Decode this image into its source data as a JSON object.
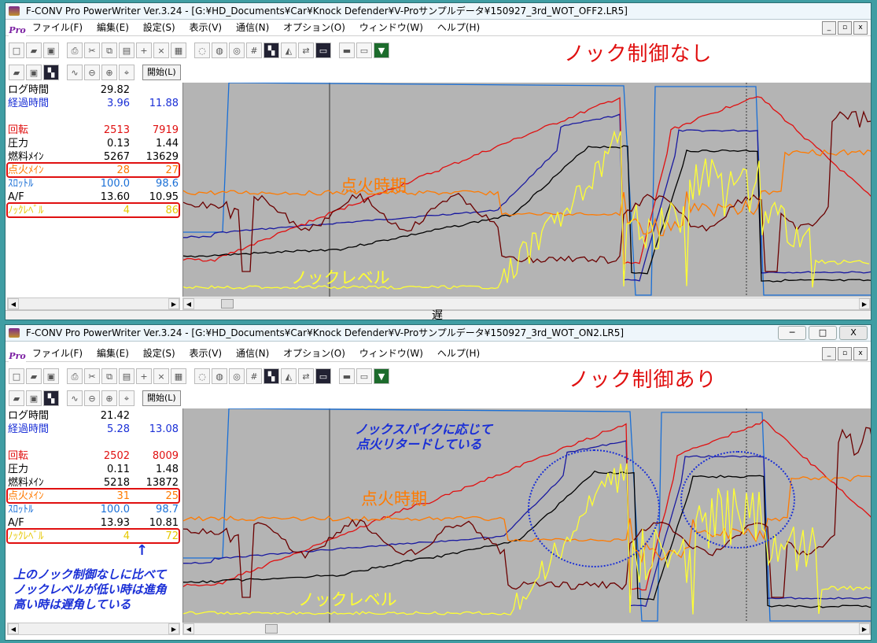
{
  "windows": [
    {
      "title": "F-CONV Pro PowerWriter Ver.3.24 - [G:¥HD_Documents¥Car¥Knock Defender¥V-Proサンプルデータ¥150927_3rd_WOT_OFF2.LR5]",
      "heading": "ノック制御なし",
      "rows": [
        {
          "label": "ログ時間",
          "v1": "29.82",
          "v2": "",
          "color": "#000000"
        },
        {
          "label": "経過時間",
          "v1": "3.96",
          "v2": "11.88",
          "color": "#1a2fd6"
        },
        {
          "label": "回転",
          "v1": "2513",
          "v2": "7919",
          "color": "#e01010"
        },
        {
          "label": "圧力",
          "v1": "0.13",
          "v2": "1.44",
          "color": "#000000"
        },
        {
          "label": "燃料ﾒｲﾝ",
          "v1": "5267",
          "v2": "13629",
          "color": "#000000"
        },
        {
          "label": "点火ﾒｲﾝ",
          "v1": "28",
          "v2": "27",
          "color": "#ff7a00"
        },
        {
          "label": "ｽﾛｯﾄﾙ",
          "v1": "100.0",
          "v2": "98.6",
          "color": "#1a6fd6"
        },
        {
          "label": "A/F",
          "v1": "13.60",
          "v2": "10.95",
          "color": "#000000"
        },
        {
          "label": "ﾉｯｸﾚﾍﾞﾙ",
          "v1": "4",
          "v2": "86",
          "color": "#e6c800"
        }
      ],
      "labels": {
        "ignition": "点火時期",
        "knock": "ノックレベル"
      }
    },
    {
      "title": "F-CONV Pro PowerWriter Ver.3.24 - [G:¥HD_Documents¥Car¥Knock Defender¥V-Proサンプルデータ¥150927_3rd_WOT_ON2.LR5]",
      "heading": "ノック制御あり",
      "rows": [
        {
          "label": "ログ時間",
          "v1": "21.42",
          "v2": "",
          "color": "#000000"
        },
        {
          "label": "経過時間",
          "v1": "5.28",
          "v2": "13.08",
          "color": "#1a2fd6"
        },
        {
          "label": "回転",
          "v1": "2502",
          "v2": "8009",
          "color": "#e01010"
        },
        {
          "label": "圧力",
          "v1": "0.11",
          "v2": "1.48",
          "color": "#000000"
        },
        {
          "label": "燃料ﾒｲﾝ",
          "v1": "5218",
          "v2": "13872",
          "color": "#000000"
        },
        {
          "label": "点火ﾒｲﾝ",
          "v1": "31",
          "v2": "25",
          "color": "#ff7a00"
        },
        {
          "label": "ｽﾛｯﾄﾙ",
          "v1": "100.0",
          "v2": "98.7",
          "color": "#1a6fd6"
        },
        {
          "label": "A/F",
          "v1": "13.93",
          "v2": "10.81",
          "color": "#000000"
        },
        {
          "label": "ﾉｯｸﾚﾍﾞﾙ",
          "v1": "4",
          "v2": "72",
          "color": "#e6c800"
        }
      ],
      "labels": {
        "ignition": "点火時期",
        "knock": "ノックレベル"
      },
      "annotation_right": [
        "ノックスパイクに応じて",
        "点火リタードしている"
      ],
      "annotation_left": [
        "上のノック制御なしに比べて",
        "ノックレベルが低い時は進角",
        "高い時は遅角している"
      ],
      "arrow_symbol": "↑"
    }
  ],
  "menu": [
    "ファイル(F)",
    "編集(E)",
    "設定(S)",
    "表示(V)",
    "通信(N)",
    "オプション(O)",
    "ウィンドウ(W)",
    "ヘルプ(H)"
  ],
  "start_button": "開始(L)",
  "divider_label": "遅",
  "window_buttons": {
    "minimize": "─",
    "maximize": "□",
    "close": "X"
  },
  "app_badge": "Pro",
  "colors": {
    "rpm": "#e01010",
    "boost": "#000000",
    "fuel": "#000000",
    "ignition": "#ff7a00",
    "throttle": "#1a6fd6",
    "af": "#6b0000",
    "knock": "#ffff33",
    "plot_bg": "#b4b4b4"
  }
}
